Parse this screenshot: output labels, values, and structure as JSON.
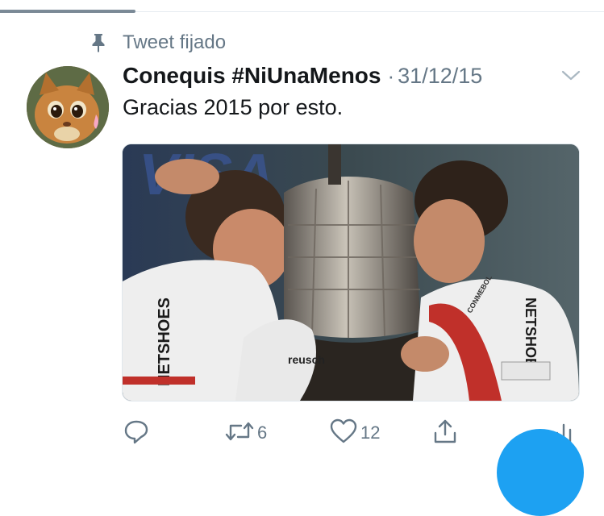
{
  "pinned": {
    "label": "Tweet fijado"
  },
  "tweet": {
    "author_name": "Conequis #NiUnaMenos",
    "separator": "·",
    "date": "31/12/15",
    "text": "Gracias 2015 por esto.",
    "media": {
      "background_text": "VISA",
      "jersey_sponsor": "NETSHOES",
      "glove_brand": "reusch",
      "armband_text": "CONMEBOL"
    }
  },
  "actions": {
    "retweets": "6",
    "likes": "12"
  },
  "colors": {
    "accent": "#1da1f2",
    "secondary_text": "#657786",
    "primary_text": "#14171a"
  },
  "icons": {
    "pin": "pin-icon",
    "caret": "chevron-down-icon",
    "reply": "reply-icon",
    "retweet": "retweet-icon",
    "like": "heart-icon",
    "share": "share-icon",
    "analytics": "analytics-icon"
  }
}
